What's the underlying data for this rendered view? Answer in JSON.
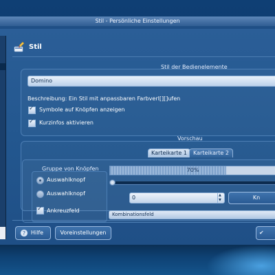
{
  "window": {
    "title": "Stil - Persönliche Einstellungen"
  },
  "header": {
    "title": "Stil",
    "icon": "style-brush-icon"
  },
  "widget_style": {
    "group_title": "Stil der Bedienelemente",
    "selected_style": "Domino",
    "description": "Beschreibung: Ein Stil mit anpassbaren Farbverl[][]ufen",
    "checkboxes": [
      {
        "label": "Symbole auf Knöpfen anzeigen",
        "checked": true
      },
      {
        "label": "Kurzinfos aktivieren",
        "checked": true
      }
    ]
  },
  "preview": {
    "title": "Vorschau",
    "tabs": [
      {
        "label": "Karteikarte 1",
        "active": true
      },
      {
        "label": "Karteikarte 2",
        "active": false
      }
    ],
    "button_group_title": "Gruppe von Knöpfen",
    "radios": [
      {
        "label": "Auswahlknopf",
        "selected": true
      },
      {
        "label": "Auswahlknopf",
        "selected": false
      }
    ],
    "checkbox_label": "Ankreuzfeld",
    "progress_label": "70%",
    "progress_value": 0.7,
    "spin_value": "0",
    "button_label": "Kn",
    "combo_label": "Kombinationsfeld"
  },
  "buttons": {
    "help": "Hilfe",
    "defaults": "Voreinstellungen"
  },
  "colors": {
    "accent": "#23578f",
    "titlebar": "#2f5d92"
  }
}
